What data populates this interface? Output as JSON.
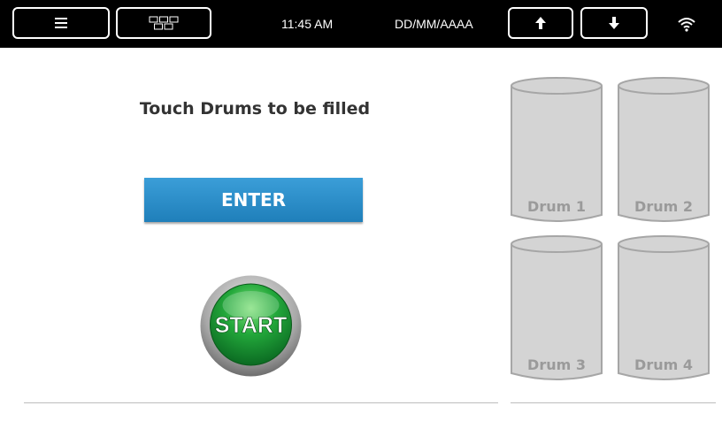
{
  "status_bar": {
    "time": "11:45 AM",
    "date": "DD/MM/AAAA",
    "menu_icon": "hamburger-icon",
    "grid_icon": "grid-icon",
    "up_icon": "arrow-up-icon",
    "down_icon": "arrow-down-icon",
    "wifi_icon": "wifi-icon"
  },
  "main": {
    "prompt": "Touch Drums to be filled",
    "enter_label": "ENTER",
    "start_label": "START"
  },
  "drums": [
    {
      "label": "Drum 1"
    },
    {
      "label": "Drum 2"
    },
    {
      "label": "Drum 3"
    },
    {
      "label": "Drum 4"
    }
  ],
  "colors": {
    "accent_blue": "#2a8fce",
    "start_green": "#1f9a3c",
    "drum_fill": "#d4d4d4"
  }
}
